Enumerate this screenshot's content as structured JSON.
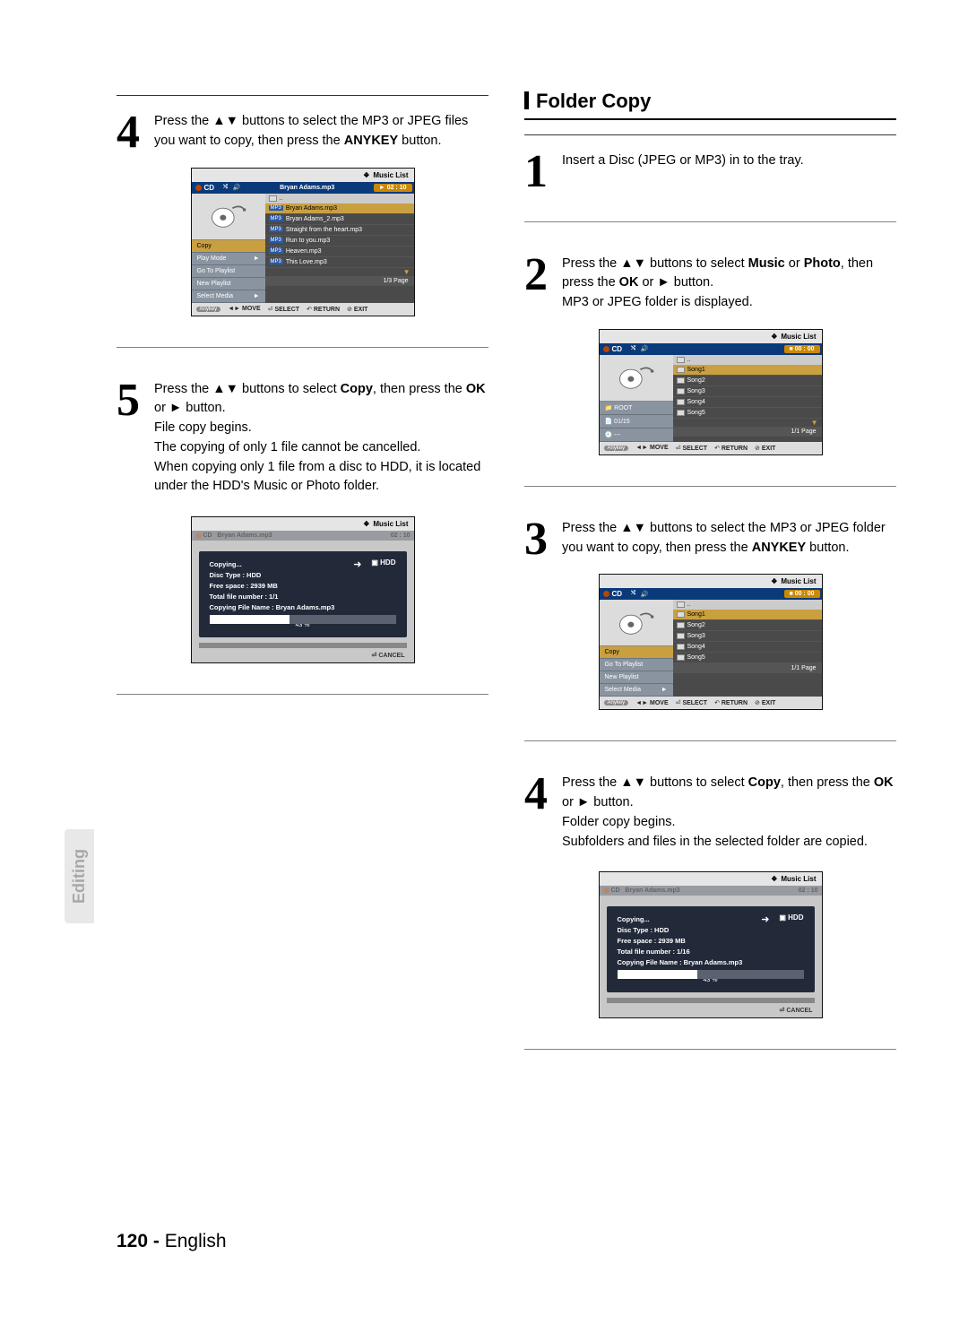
{
  "side_tab": "Editing",
  "footer": {
    "page": "120 -",
    "lang": "English"
  },
  "left": {
    "step4": {
      "text_a": "Press the ",
      "text_b": " buttons to select the MP3 or JPEG files you want to copy, then press the ",
      "anykey": "ANYKEY",
      "text_c": " button."
    },
    "ui1": {
      "title": "Music List",
      "cd": "CD",
      "track": "Bryan Adams.mp3",
      "time_prefix": "►",
      "time": "02 : 10",
      "folder_up": "..",
      "files": [
        "Bryan Adams.mp3",
        "Bryan Adams_2.mp3",
        "Straight from the heart.mp3",
        "Run to you.mp3",
        "Heaven.mp3",
        "This Love.mp3"
      ],
      "menu": [
        "Copy",
        "Play Mode",
        "Go To Playlist",
        "New Playlist",
        "Select Media"
      ],
      "pager": "1/3 Page",
      "nav": {
        "anykey": "Anykey",
        "move": "MOVE",
        "select": "SELECT",
        "return": "RETURN",
        "exit": "EXIT"
      }
    },
    "step5": {
      "text_a": "Press the ",
      "text_b": " buttons to select ",
      "copy": "Copy",
      "text_c": ", then press the ",
      "ok": "OK",
      "text_d": " or ",
      "text_e": " button.",
      "line2": "File copy begins.",
      "line3": "The copying of only 1 file cannot be cancelled.",
      "line4": "When copying only 1 file from a disc to HDD, it is located under the HDD's Music or Photo folder."
    },
    "ui2": {
      "title": "Music List",
      "cd": "CD",
      "track": "Bryan Adams.mp3",
      "time": "02 : 10",
      "copying": "Copying...",
      "hdd": "HDD",
      "lines": [
        "Disc Type : HDD",
        "Free space : 2939 MB",
        "Total file number : 1/1",
        "Copying File Name : Bryan Adams.mp3"
      ],
      "percent": "43 %",
      "cancel": "CANCEL"
    }
  },
  "right": {
    "section_title": "Folder Copy",
    "step1": {
      "text": "Insert a Disc (JPEG or MP3) in to the tray."
    },
    "step2": {
      "text_a": "Press the ",
      "text_b": " buttons to select ",
      "music": "Music",
      "or": " or ",
      "photo": "Photo",
      "text_c": ", then press the ",
      "ok": "OK",
      "text_d": " or ",
      "text_e": " button.",
      "line2": "MP3 or JPEG folder is displayed."
    },
    "ui3": {
      "title": "Music List",
      "cd": "CD",
      "time": "00 : 00",
      "folder_up": "..",
      "songs": [
        "Song1",
        "Song2",
        "Song3",
        "Song4",
        "Song5"
      ],
      "root": "ROOT",
      "counter": "01/15",
      "dash": "---",
      "pager": "1/1 Page",
      "nav": {
        "anykey": "Anykey",
        "move": "MOVE",
        "select": "SELECT",
        "return": "RETURN",
        "exit": "EXIT"
      }
    },
    "step3": {
      "text_a": "Press the ",
      "text_b": " buttons to select the MP3 or JPEG folder you want to copy, then press the ",
      "anykey": "ANYKEY",
      "text_c": " button."
    },
    "ui4": {
      "title": "Music List",
      "cd": "CD",
      "time": "00 : 00",
      "folder_up": "..",
      "songs": [
        "Song1",
        "Song2",
        "Song3",
        "Song4",
        "Song5"
      ],
      "menu": [
        "Copy",
        "Go To Playlist",
        "New Playlist",
        "Select Media"
      ],
      "pager": "1/1 Page",
      "nav": {
        "anykey": "Anykey",
        "move": "MOVE",
        "select": "SELECT",
        "return": "RETURN",
        "exit": "EXIT"
      }
    },
    "step4": {
      "text_a": "Press the ",
      "text_b": " buttons to select ",
      "copy": "Copy",
      "text_c": ", then press the ",
      "ok": "OK",
      "text_d": " or ",
      "text_e": " button.",
      "line2": "Folder copy begins.",
      "line3": "Subfolders and files in the selected folder are copied."
    },
    "ui5": {
      "title": "Music List",
      "cd": "CD",
      "track": "Bryan Adams.mp3",
      "time": "02 : 10",
      "copying": "Copying...",
      "hdd": "HDD",
      "lines": [
        "Disc Type : HDD",
        "Free space : 2939 MB",
        "Total file number : 1/16",
        "Copying File Name : Bryan Adams.mp3"
      ],
      "percent": "43 %",
      "cancel": "CANCEL"
    }
  }
}
